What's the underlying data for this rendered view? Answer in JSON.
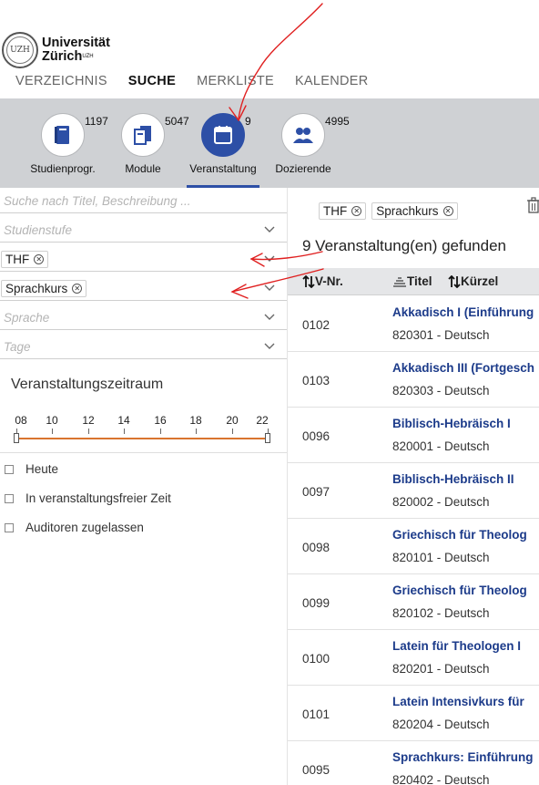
{
  "logo": {
    "line1": "Universität",
    "line2": "Zürich",
    "suffix": "UZH"
  },
  "nav": {
    "items": [
      "VERZEICHNIS",
      "SUCHE",
      "MERKLISTE",
      "KALENDER"
    ],
    "active_index": 1
  },
  "categories": [
    {
      "label": "Studienprogr.",
      "count": "1197",
      "icon": "book-icon",
      "active": false
    },
    {
      "label": "Module",
      "count": "5047",
      "icon": "modules-icon",
      "active": false
    },
    {
      "label": "Veranstaltung",
      "count": "9",
      "icon": "calendar-icon",
      "active": true
    },
    {
      "label": "Dozierende",
      "count": "4995",
      "icon": "people-icon",
      "active": false
    }
  ],
  "filters": {
    "search_placeholder": "Suche nach Titel, Beschreibung ...",
    "level_placeholder": "Studienstufe",
    "faculty_tag": "THF",
    "type_tag": "Sprachkurs",
    "language_placeholder": "Sprache",
    "days_placeholder": "Tage",
    "period_title": "Veranstaltungszeitraum",
    "hour_ticks": [
      "08",
      "10",
      "12",
      "14",
      "16",
      "18",
      "20",
      "22"
    ],
    "range": [
      8,
      22
    ],
    "checkboxes": [
      "Heute",
      "In veranstaltungsfreier Zeit",
      "Auditoren zugelassen"
    ]
  },
  "results": {
    "active_filters": [
      "THF",
      "Sprachkurs"
    ],
    "count_text": "9 Veranstaltung(en) gefunden",
    "columns": {
      "number": "V-Nr.",
      "title": "Titel",
      "short": "Kürzel"
    },
    "rows": [
      {
        "number": "0102",
        "title": "Akkadisch I (Einführung",
        "subtitle": "820301 - Deutsch"
      },
      {
        "number": "0103",
        "title": "Akkadisch III (Fortgesch",
        "subtitle": "820303 - Deutsch"
      },
      {
        "number": "0096",
        "title": "Biblisch-Hebräisch I",
        "subtitle": "820001 - Deutsch"
      },
      {
        "number": "0097",
        "title": "Biblisch-Hebräisch II",
        "subtitle": "820002 - Deutsch"
      },
      {
        "number": "0098",
        "title": "Griechisch für Theolog",
        "subtitle": "820101 - Deutsch"
      },
      {
        "number": "0099",
        "title": "Griechisch für Theolog",
        "subtitle": "820102 - Deutsch"
      },
      {
        "number": "0100",
        "title": "Latein für Theologen I",
        "subtitle": "820201 - Deutsch"
      },
      {
        "number": "0101",
        "title": "Latein Intensivkurs für",
        "subtitle": "820204 - Deutsch"
      },
      {
        "number": "0095",
        "title": "Sprachkurs: Einführung",
        "subtitle": "820402 - Deutsch"
      }
    ]
  },
  "colors": {
    "brand_blue": "#2d4fa6",
    "link_blue": "#1c3b8a",
    "slider_orange": "#d9742f",
    "annotation_red": "#e02020"
  }
}
